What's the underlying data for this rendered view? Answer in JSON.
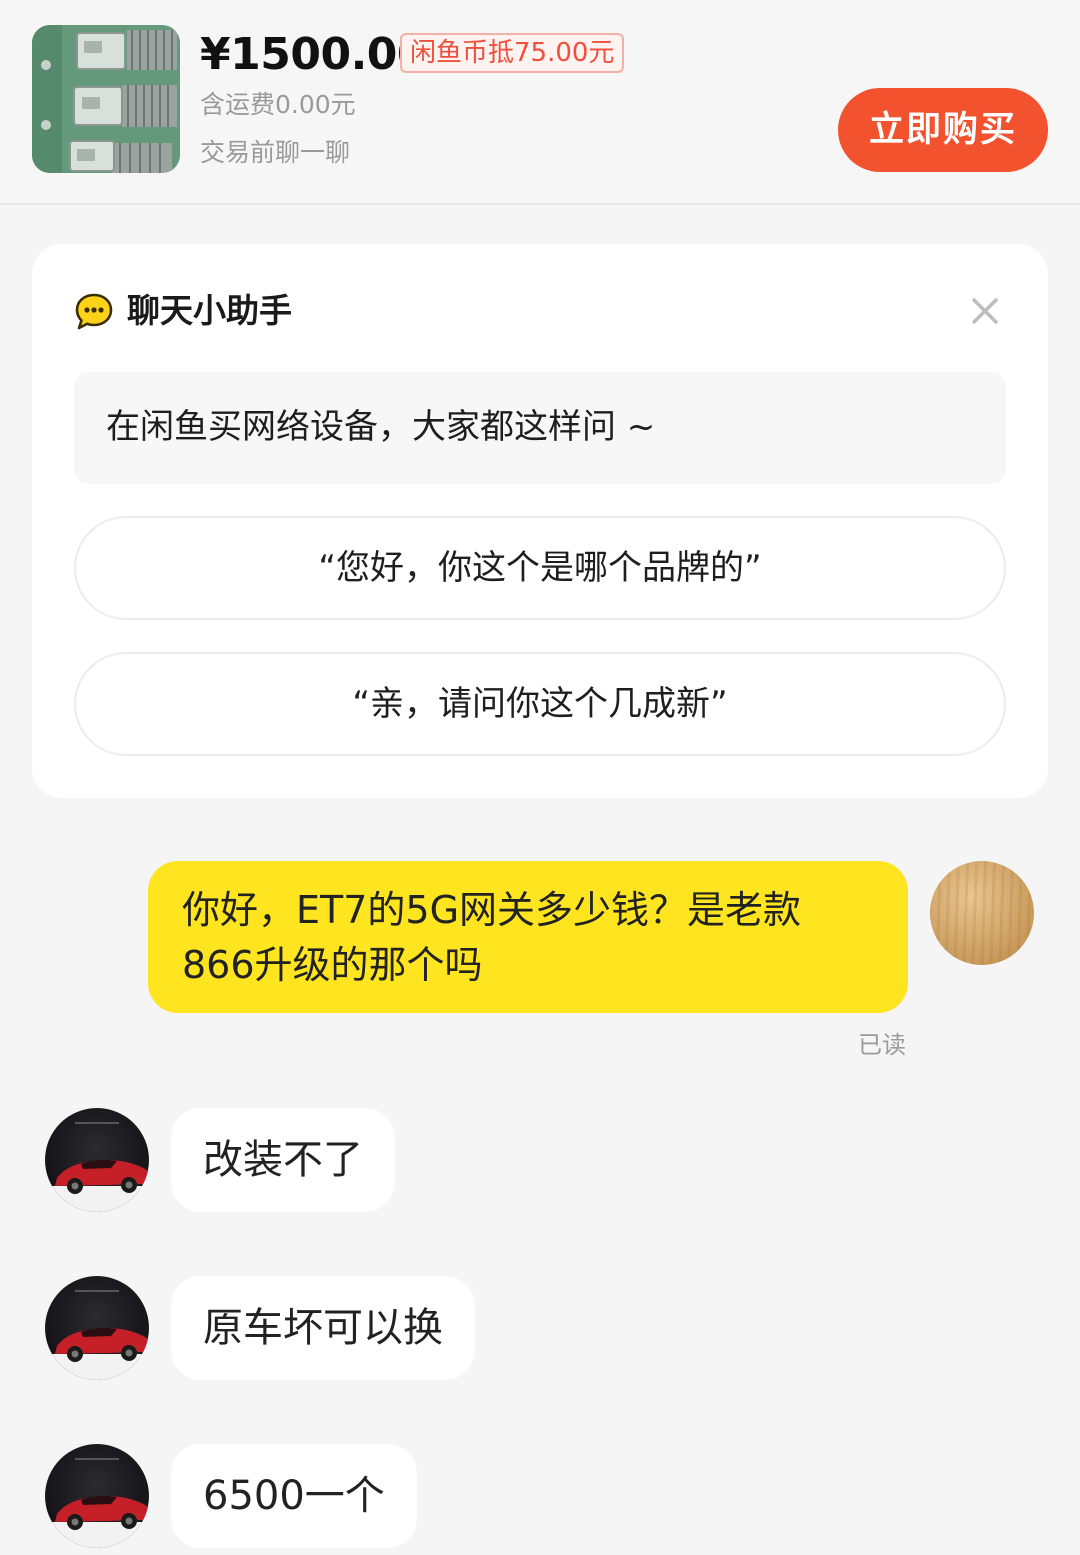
{
  "product": {
    "price": "¥1500.00",
    "coin_deduction": "闲鱼币抵75.00元",
    "shipping": "含运费0.00元",
    "chat_prompt": "交易前聊一聊",
    "buy_button": "立即购买"
  },
  "assistant": {
    "title": "聊天小助手",
    "hint": "在闲鱼买网络设备，大家都这样问 ~",
    "quick_questions": [
      "“您好，你这个是哪个品牌的”",
      "“亲，请问你这个几成新”"
    ]
  },
  "messages": {
    "mine": {
      "line1": "你好，ET7的5G网关多少钱？是老款",
      "line2": "866升级的那个吗",
      "status": "已读"
    },
    "seller": [
      "改装不了",
      "原车坏可以换",
      "6500一个"
    ]
  },
  "colors": {
    "accent": "#f2522e",
    "my_bubble": "#ffe51f",
    "background": "#f5f5f5"
  },
  "icons": {
    "assistant": "chat-bubble-icon",
    "close": "close-icon"
  }
}
